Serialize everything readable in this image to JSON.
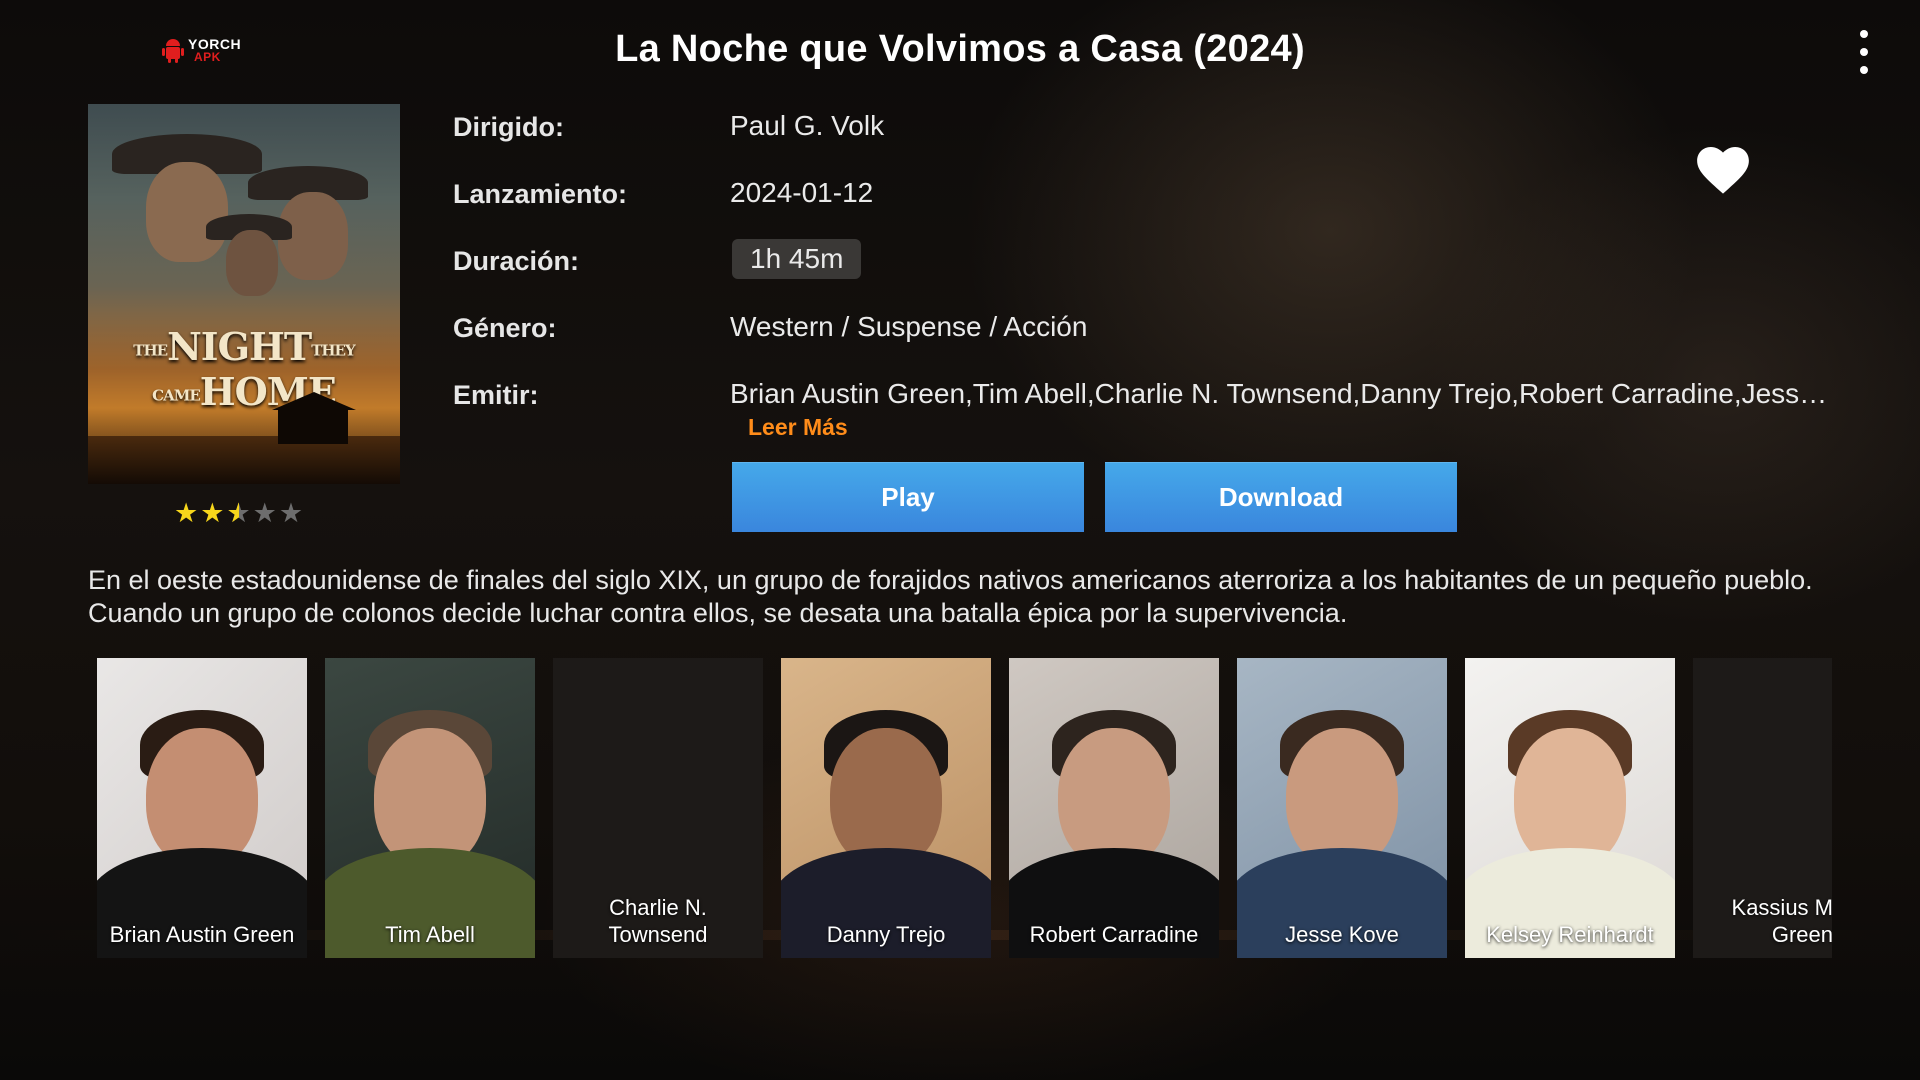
{
  "header": {
    "logo_text": "YORCH",
    "logo_sub": "APK",
    "title": "La Noche que Volvimos a Casa (2024)",
    "menu_icon": "more-vertical-icon"
  },
  "poster": {
    "title_main_1": "THE",
    "title_main_2": "NIGHT",
    "title_small": "THEY CAME",
    "title_main_3": "HOME"
  },
  "rating": {
    "value": 2.5,
    "max": 5
  },
  "details": {
    "directed_label": "Dirigido:",
    "directed_value": "Paul G. Volk",
    "release_label": "Lanzamiento:",
    "release_value": "2024-01-12",
    "duration_label": "Duración:",
    "duration_value": "1h 45m",
    "genre_label": "Género:",
    "genre_value": "Western / Suspense / Acción",
    "cast_label": "Emitir:",
    "cast_value": "Brian Austin Green,Tim Abell,Charlie N. Townsend,Danny Trejo,Robert Carradine,Jesse Kove,Kelsey Reinhardt,Kassius Marcil-Green",
    "read_more": "Leer Más"
  },
  "favorite_icon": "heart-icon",
  "buttons": {
    "play": "Play",
    "download": "Download"
  },
  "synopsis": "En el oeste estadounidense de finales del siglo XIX, un grupo de forajidos nativos americanos aterroriza a los habitantes de un pequeño pueblo. Cuando un grupo de colonos decide luchar contra ellos, se desata una batalla épica por la supervivencia.",
  "cast": [
    {
      "name": "Brian Austin Green"
    },
    {
      "name": "Tim Abell"
    },
    {
      "name": "Charlie N. Townsend"
    },
    {
      "name": "Danny Trejo"
    },
    {
      "name": "Robert Carradine"
    },
    {
      "name": "Jesse Kove"
    },
    {
      "name": "Kelsey Reinhardt"
    },
    {
      "name": "Kassius M Green"
    }
  ],
  "colors": {
    "accent_orange": "#ff8c1a",
    "button_blue": "#3f97e4",
    "star_yellow": "#f7d61b"
  }
}
